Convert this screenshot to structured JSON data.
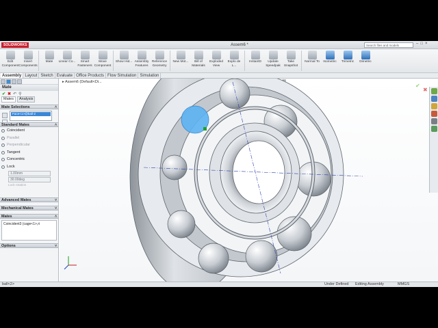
{
  "app": {
    "brand": "SOLIDWORKS",
    "title": "Assem6 *",
    "search_placeholder": "Search files and models"
  },
  "toolbar": [
    {
      "label": "Edit Component",
      "icon": "edit-component-icon"
    },
    {
      "label": "Insert Components",
      "icon": "insert-components-icon"
    },
    {
      "label": "Mate",
      "icon": "mate-icon"
    },
    {
      "label": "Linear Co...",
      "icon": "linear-pattern-icon"
    },
    {
      "label": "Smart Fasteners",
      "icon": "smart-fasteners-icon"
    },
    {
      "label": "Move Component",
      "icon": "move-component-icon"
    },
    {
      "label": "Show Hid...",
      "icon": "show-hidden-icon"
    },
    {
      "label": "Assembly Features",
      "icon": "assembly-features-icon"
    },
    {
      "label": "Reference Geometry",
      "icon": "reference-geometry-icon"
    },
    {
      "label": "New Mot...",
      "icon": "new-motion-study-icon"
    },
    {
      "label": "Bill of Materials",
      "icon": "bill-of-materials-icon"
    },
    {
      "label": "Exploded View",
      "icon": "exploded-view-icon"
    },
    {
      "label": "Explo de L...",
      "icon": "explode-line-icon"
    },
    {
      "label": "InstantD",
      "icon": "instant3d-icon"
    },
    {
      "label": "Update Speedpak",
      "icon": "speedpak-icon"
    },
    {
      "label": "Take Snapshot",
      "icon": "snapshot-icon"
    },
    {
      "label": "Normal To",
      "icon": "normal-to-icon"
    },
    {
      "label": "Isometric",
      "icon": "isometric-icon"
    },
    {
      "label": "Trimetric",
      "icon": "trimetric-icon"
    },
    {
      "label": "Dimetric",
      "icon": "dimetric-icon"
    }
  ],
  "tabs": [
    "Assembly",
    "Layout",
    "Sketch",
    "Evaluate",
    "Office Products",
    "Flow Simulation",
    "Simulation"
  ],
  "panel": {
    "mate_title": "Mate",
    "mate_tabs": [
      "Mates",
      "Analysis"
    ],
    "mate_selections_header": "Mate Selections",
    "selections": [
      "Face<1>@ball-2"
    ],
    "standard_mates_header": "Standard Mates",
    "standard_mates": [
      {
        "label": "Coincident",
        "enabled": true
      },
      {
        "label": "Parallel",
        "enabled": false
      },
      {
        "label": "Perpendicular",
        "enabled": false
      },
      {
        "label": "Tangent",
        "enabled": true
      },
      {
        "label": "Concentric",
        "enabled": true
      },
      {
        "label": "Lock",
        "enabled": true
      }
    ],
    "distance_value": "1.00mm",
    "angle_value": "30.00deg",
    "lock_rotation_label": "Lock rotation",
    "advanced_header": "Advanced Mates",
    "mechanical_header": "Mechanical Mates",
    "mates_header": "Mates",
    "mates_list": [
      "Coincident3 (cage<1>,ri"
    ],
    "options_header": "Options"
  },
  "viewport": {
    "tree_label": "Assem6  (Default<Di..."
  },
  "status": {
    "left": "ball<2>",
    "state": "Under Defined",
    "mode": "Editing Assembly",
    "units": "MMGS"
  },
  "colors": {
    "selection_blue": "#3b86d6",
    "accent_green": "#1fa12a",
    "bearing_steel": "#b9bec5"
  }
}
